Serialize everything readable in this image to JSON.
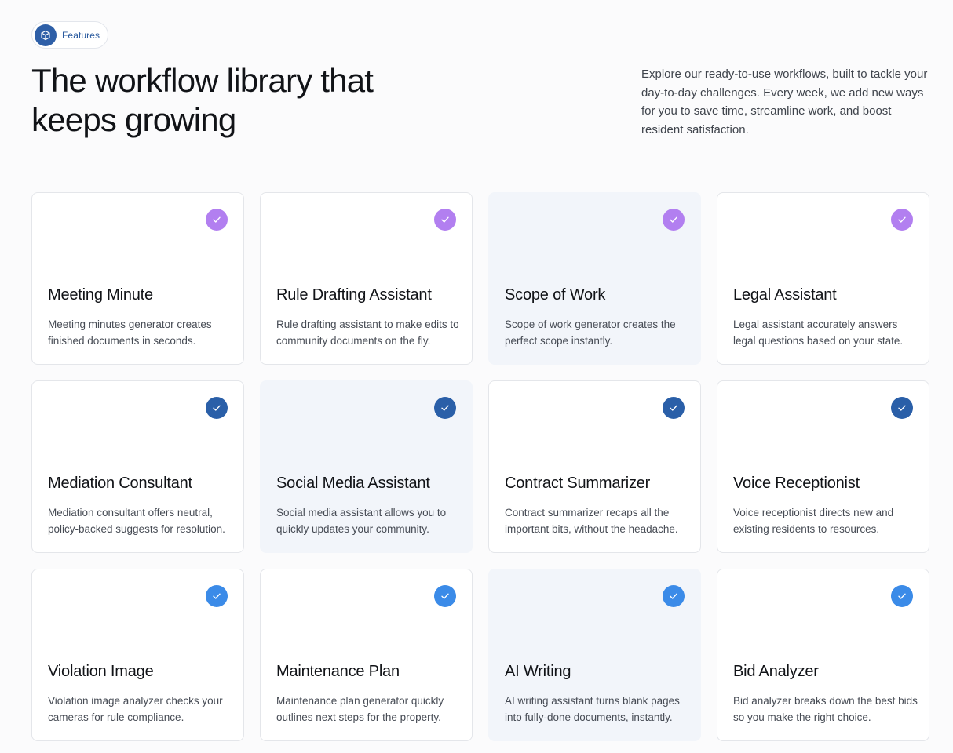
{
  "badge": {
    "label": "Features",
    "icon": "cube-icon",
    "color": "#2e5fa7"
  },
  "headline": "The workflow library that keeps growing",
  "intro": "Explore our ready-to-use workflows, built to tackle your day-to-day challenges. Every week, we add new ways for you to save time, streamline work, and boost resident satisfaction.",
  "check_icon": "checkmark-icon",
  "colors": {
    "purple": "#b27ff0",
    "navy": "#2a5fa8",
    "blue": "#3b8be8",
    "shaded_card": "#f2f5fa"
  },
  "cards": [
    {
      "title": "Meeting Minute",
      "desc": "Meeting minutes generator creates finished documents in seconds.",
      "check_color": "#b27ff0",
      "shaded": false
    },
    {
      "title": "Rule Drafting Assistant",
      "desc": "Rule drafting assistant to make edits to community documents on the fly.",
      "check_color": "#b27ff0",
      "shaded": false
    },
    {
      "title": "Scope of Work",
      "desc": "Scope of work generator creates the perfect scope instantly.",
      "check_color": "#b27ff0",
      "shaded": true
    },
    {
      "title": "Legal Assistant",
      "desc": "Legal assistant accurately answers legal questions based on your state.",
      "check_color": "#b27ff0",
      "shaded": false
    },
    {
      "title": "Mediation Consultant",
      "desc": "Mediation consultant offers neutral, policy-backed suggests for resolution.",
      "check_color": "#2a5fa8",
      "shaded": false
    },
    {
      "title": "Social Media Assistant",
      "desc": "Social media assistant allows you to quickly updates your community.",
      "check_color": "#2a5fa8",
      "shaded": true
    },
    {
      "title": "Contract Summarizer",
      "desc": "Contract summarizer recaps all the important bits, without the headache.",
      "check_color": "#2a5fa8",
      "shaded": false
    },
    {
      "title": "Voice Receptionist",
      "desc": "Voice receptionist directs new and existing residents to resources.",
      "check_color": "#2a5fa8",
      "shaded": false
    },
    {
      "title": "Violation Image",
      "desc": "Violation image analyzer checks your cameras for rule compliance.",
      "check_color": "#3b8be8",
      "shaded": false
    },
    {
      "title": "Maintenance Plan",
      "desc": "Maintenance plan generator quickly outlines next steps for the property.",
      "check_color": "#3b8be8",
      "shaded": false
    },
    {
      "title": "AI Writing",
      "desc": "AI writing assistant turns blank pages into fully-done documents, instantly.",
      "check_color": "#3b8be8",
      "shaded": true
    },
    {
      "title": "Bid Analyzer",
      "desc": "Bid analyzer breaks down the best bids so you make the right choice.",
      "check_color": "#3b8be8",
      "shaded": false
    }
  ]
}
